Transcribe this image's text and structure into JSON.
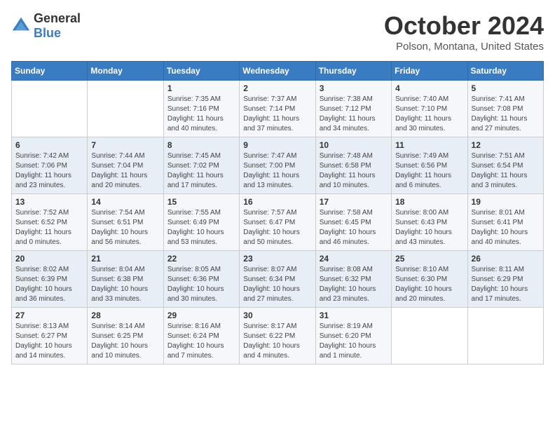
{
  "header": {
    "logo": {
      "general": "General",
      "blue": "Blue"
    },
    "title": "October 2024",
    "location": "Polson, Montana, United States"
  },
  "days_of_week": [
    "Sunday",
    "Monday",
    "Tuesday",
    "Wednesday",
    "Thursday",
    "Friday",
    "Saturday"
  ],
  "weeks": [
    [
      {
        "day": "",
        "detail": ""
      },
      {
        "day": "",
        "detail": ""
      },
      {
        "day": "1",
        "detail": "Sunrise: 7:35 AM\nSunset: 7:16 PM\nDaylight: 11 hours and 40 minutes."
      },
      {
        "day": "2",
        "detail": "Sunrise: 7:37 AM\nSunset: 7:14 PM\nDaylight: 11 hours and 37 minutes."
      },
      {
        "day": "3",
        "detail": "Sunrise: 7:38 AM\nSunset: 7:12 PM\nDaylight: 11 hours and 34 minutes."
      },
      {
        "day": "4",
        "detail": "Sunrise: 7:40 AM\nSunset: 7:10 PM\nDaylight: 11 hours and 30 minutes."
      },
      {
        "day": "5",
        "detail": "Sunrise: 7:41 AM\nSunset: 7:08 PM\nDaylight: 11 hours and 27 minutes."
      }
    ],
    [
      {
        "day": "6",
        "detail": "Sunrise: 7:42 AM\nSunset: 7:06 PM\nDaylight: 11 hours and 23 minutes."
      },
      {
        "day": "7",
        "detail": "Sunrise: 7:44 AM\nSunset: 7:04 PM\nDaylight: 11 hours and 20 minutes."
      },
      {
        "day": "8",
        "detail": "Sunrise: 7:45 AM\nSunset: 7:02 PM\nDaylight: 11 hours and 17 minutes."
      },
      {
        "day": "9",
        "detail": "Sunrise: 7:47 AM\nSunset: 7:00 PM\nDaylight: 11 hours and 13 minutes."
      },
      {
        "day": "10",
        "detail": "Sunrise: 7:48 AM\nSunset: 6:58 PM\nDaylight: 11 hours and 10 minutes."
      },
      {
        "day": "11",
        "detail": "Sunrise: 7:49 AM\nSunset: 6:56 PM\nDaylight: 11 hours and 6 minutes."
      },
      {
        "day": "12",
        "detail": "Sunrise: 7:51 AM\nSunset: 6:54 PM\nDaylight: 11 hours and 3 minutes."
      }
    ],
    [
      {
        "day": "13",
        "detail": "Sunrise: 7:52 AM\nSunset: 6:52 PM\nDaylight: 11 hours and 0 minutes."
      },
      {
        "day": "14",
        "detail": "Sunrise: 7:54 AM\nSunset: 6:51 PM\nDaylight: 10 hours and 56 minutes."
      },
      {
        "day": "15",
        "detail": "Sunrise: 7:55 AM\nSunset: 6:49 PM\nDaylight: 10 hours and 53 minutes."
      },
      {
        "day": "16",
        "detail": "Sunrise: 7:57 AM\nSunset: 6:47 PM\nDaylight: 10 hours and 50 minutes."
      },
      {
        "day": "17",
        "detail": "Sunrise: 7:58 AM\nSunset: 6:45 PM\nDaylight: 10 hours and 46 minutes."
      },
      {
        "day": "18",
        "detail": "Sunrise: 8:00 AM\nSunset: 6:43 PM\nDaylight: 10 hours and 43 minutes."
      },
      {
        "day": "19",
        "detail": "Sunrise: 8:01 AM\nSunset: 6:41 PM\nDaylight: 10 hours and 40 minutes."
      }
    ],
    [
      {
        "day": "20",
        "detail": "Sunrise: 8:02 AM\nSunset: 6:39 PM\nDaylight: 10 hours and 36 minutes."
      },
      {
        "day": "21",
        "detail": "Sunrise: 8:04 AM\nSunset: 6:38 PM\nDaylight: 10 hours and 33 minutes."
      },
      {
        "day": "22",
        "detail": "Sunrise: 8:05 AM\nSunset: 6:36 PM\nDaylight: 10 hours and 30 minutes."
      },
      {
        "day": "23",
        "detail": "Sunrise: 8:07 AM\nSunset: 6:34 PM\nDaylight: 10 hours and 27 minutes."
      },
      {
        "day": "24",
        "detail": "Sunrise: 8:08 AM\nSunset: 6:32 PM\nDaylight: 10 hours and 23 minutes."
      },
      {
        "day": "25",
        "detail": "Sunrise: 8:10 AM\nSunset: 6:30 PM\nDaylight: 10 hours and 20 minutes."
      },
      {
        "day": "26",
        "detail": "Sunrise: 8:11 AM\nSunset: 6:29 PM\nDaylight: 10 hours and 17 minutes."
      }
    ],
    [
      {
        "day": "27",
        "detail": "Sunrise: 8:13 AM\nSunset: 6:27 PM\nDaylight: 10 hours and 14 minutes."
      },
      {
        "day": "28",
        "detail": "Sunrise: 8:14 AM\nSunset: 6:25 PM\nDaylight: 10 hours and 10 minutes."
      },
      {
        "day": "29",
        "detail": "Sunrise: 8:16 AM\nSunset: 6:24 PM\nDaylight: 10 hours and 7 minutes."
      },
      {
        "day": "30",
        "detail": "Sunrise: 8:17 AM\nSunset: 6:22 PM\nDaylight: 10 hours and 4 minutes."
      },
      {
        "day": "31",
        "detail": "Sunrise: 8:19 AM\nSunset: 6:20 PM\nDaylight: 10 hours and 1 minute."
      },
      {
        "day": "",
        "detail": ""
      },
      {
        "day": "",
        "detail": ""
      }
    ]
  ]
}
